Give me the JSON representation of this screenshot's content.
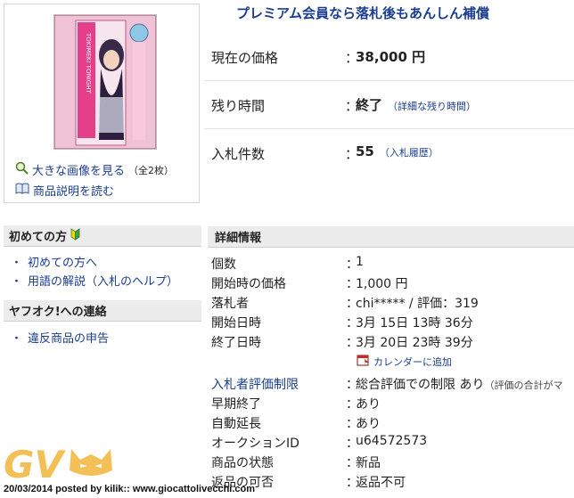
{
  "banner": {
    "text": "プレミアム会員なら落札後もあんしん補償"
  },
  "image_panel": {
    "package_text_top": "TOKIMEKI TONIGHT",
    "enlarge_link": "大きな画像を見る",
    "enlarge_count": "（全2枚）",
    "description_link": "商品説明を読む"
  },
  "price_info": {
    "current_price_label": "現在の価格",
    "current_price_value": "38,000 円",
    "time_left_label": "残り時間",
    "time_left_value": "終了",
    "time_left_link": "（詳細な残り時間）",
    "bids_label": "入札件数",
    "bids_value": "55",
    "bids_link": "（入札履歴）",
    "colon": "："
  },
  "sidebar": {
    "beginners_head": "初めての方",
    "beginners_links": [
      "初めての方へ",
      "用語の解説（入札のヘルプ）"
    ],
    "contact_head": "ヤフオク!への連絡",
    "contact_links": [
      "違反商品の申告"
    ]
  },
  "details": {
    "head": "詳細情報",
    "rows": [
      {
        "label": "個数",
        "value": "1"
      },
      {
        "label": "開始時の価格",
        "value": "1,000 円"
      },
      {
        "label": "落札者",
        "value": "chi***** / 評価：319"
      },
      {
        "label": "開始日時",
        "value": "3月 15日 13時 36分"
      },
      {
        "label": "終了日時",
        "value": "3月 20日 23時 39分"
      },
      {
        "label": "入札者評価制限",
        "value": "総合評価での制限 あり",
        "note": "（評価の合計がマ"
      },
      {
        "label": "早期終了",
        "value": "あり"
      },
      {
        "label": "自動延長",
        "value": "あり"
      },
      {
        "label": "オークションID",
        "value": "u64572573"
      },
      {
        "label": "商品の状態",
        "value": "新品"
      },
      {
        "label": "返品の可否",
        "value": "返品不可"
      }
    ],
    "calendar_link": "カレンダーに追加"
  },
  "watermark": {
    "logo_text": "GV",
    "caption": "20/03/2014 posted by kilik:: www.giocattolivecchi.com"
  },
  "colors": {
    "link": "#1a3d8f",
    "header_bg": "#ececec",
    "watermark": "#f1b53a"
  }
}
